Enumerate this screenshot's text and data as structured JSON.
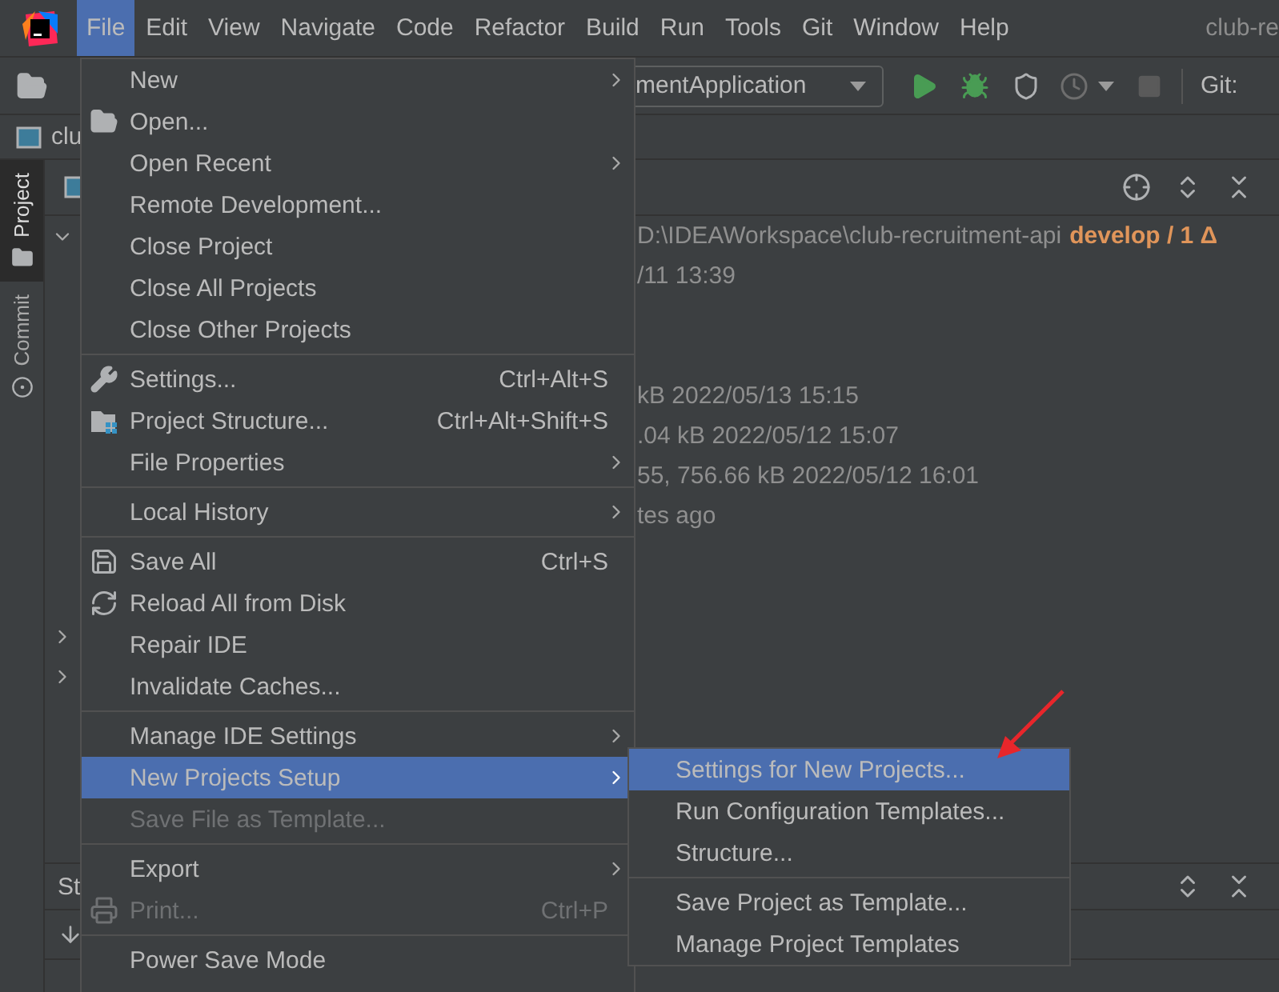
{
  "menubar": [
    {
      "label": "File",
      "selected": true
    },
    {
      "label": "Edit",
      "selected": false
    },
    {
      "label": "View",
      "selected": false
    },
    {
      "label": "Navigate",
      "selected": false
    },
    {
      "label": "Code",
      "selected": false
    },
    {
      "label": "Refactor",
      "selected": false
    },
    {
      "label": "Build",
      "selected": false
    },
    {
      "label": "Run",
      "selected": false
    },
    {
      "label": "Tools",
      "selected": false
    },
    {
      "label": "Git",
      "selected": false
    },
    {
      "label": "Window",
      "selected": false
    },
    {
      "label": "Help",
      "selected": false
    }
  ],
  "window_title": "club-re",
  "toolbar": {
    "run_configuration": "mentApplication",
    "vcs_label": "Git:"
  },
  "breadcrumb": "clu",
  "tool_window_tabs": [
    {
      "label": "Project",
      "selected": true
    },
    {
      "label": "Commit",
      "selected": false
    }
  ],
  "project_tree": [
    {
      "expandable": true,
      "expanded": true,
      "text": "D:\\IDEAWorkspace\\club-recruitment-api",
      "branch": "develop / 1 Δ"
    },
    {
      "expandable": false,
      "expanded": false,
      "text": "/11 13:39"
    },
    {
      "expandable": false,
      "expanded": false
    },
    {
      "expandable": false,
      "expanded": false
    },
    {
      "expandable": false,
      "expanded": false,
      "text": "kB 2022/05/13 15:15"
    },
    {
      "expandable": false,
      "expanded": false,
      "text": ".04 kB 2022/05/12 15:07"
    },
    {
      "expandable": false,
      "expanded": false,
      "text": "55, 756.66 kB 2022/05/12 16:01"
    },
    {
      "expandable": false,
      "expanded": false,
      "text": "tes ago"
    },
    {
      "expandable": false,
      "expanded": false
    },
    {
      "expandable": false,
      "expanded": false
    },
    {
      "expandable": true,
      "expanded": false
    },
    {
      "expandable": true,
      "expanded": false
    }
  ],
  "bottom_panel": {
    "title": "St"
  },
  "file_menu": {
    "groups": [
      [
        {
          "label": "New",
          "has_submenu": true,
          "selected": false,
          "disabled": false
        },
        {
          "label": "Open...",
          "has_submenu": false,
          "selected": false,
          "disabled": false
        },
        {
          "label": "Open Recent",
          "has_submenu": true,
          "selected": false,
          "disabled": false
        },
        {
          "label": "Remote Development...",
          "has_submenu": false,
          "selected": false,
          "disabled": false
        },
        {
          "label": "Close Project",
          "has_submenu": false,
          "selected": false,
          "disabled": false
        },
        {
          "label": "Close All Projects",
          "has_submenu": false,
          "selected": false,
          "disabled": false
        },
        {
          "label": "Close Other Projects",
          "has_submenu": false,
          "selected": false,
          "disabled": false
        }
      ],
      [
        {
          "label": "Settings...",
          "shortcut": "Ctrl+Alt+S",
          "has_submenu": false,
          "selected": false,
          "disabled": false
        },
        {
          "label": "Project Structure...",
          "shortcut": "Ctrl+Alt+Shift+S",
          "has_submenu": false,
          "selected": false,
          "disabled": false
        },
        {
          "label": "File Properties",
          "has_submenu": true,
          "selected": false,
          "disabled": false
        }
      ],
      [
        {
          "label": "Local History",
          "has_submenu": true,
          "selected": false,
          "disabled": false
        }
      ],
      [
        {
          "label": "Save All",
          "shortcut": "Ctrl+S",
          "has_submenu": false,
          "selected": false,
          "disabled": false
        },
        {
          "label": "Reload All from Disk",
          "has_submenu": false,
          "selected": false,
          "disabled": false
        },
        {
          "label": "Repair IDE",
          "has_submenu": false,
          "selected": false,
          "disabled": false
        },
        {
          "label": "Invalidate Caches...",
          "has_submenu": false,
          "selected": false,
          "disabled": false
        }
      ],
      [
        {
          "label": "Manage IDE Settings",
          "has_submenu": true,
          "selected": false,
          "disabled": false
        },
        {
          "label": "New Projects Setup",
          "has_submenu": true,
          "selected": true,
          "disabled": false
        },
        {
          "label": "Save File as Template...",
          "has_submenu": false,
          "selected": false,
          "disabled": true
        }
      ],
      [
        {
          "label": "Export",
          "has_submenu": true,
          "selected": false,
          "disabled": false
        },
        {
          "label": "Print...",
          "shortcut": "Ctrl+P",
          "has_submenu": false,
          "selected": false,
          "disabled": true
        }
      ],
      [
        {
          "label": "Power Save Mode",
          "has_submenu": false,
          "selected": false,
          "disabled": false
        }
      ]
    ]
  },
  "submenu": {
    "groups": [
      [
        {
          "label": "Settings for New Projects...",
          "selected": true
        },
        {
          "label": "Run Configuration Templates...",
          "selected": false
        },
        {
          "label": "Structure...",
          "selected": false
        }
      ],
      [
        {
          "label": "Save Project as Template...",
          "selected": false
        },
        {
          "label": "Manage Project Templates",
          "selected": false
        }
      ]
    ]
  }
}
